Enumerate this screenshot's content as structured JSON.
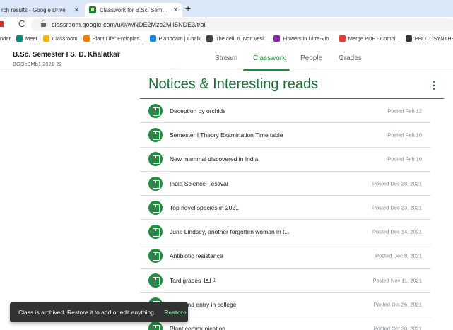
{
  "browser": {
    "tabs": [
      {
        "title": "rch results - Google Drive",
        "close": "✕"
      },
      {
        "title": "Classwork for B.Sc. Semester I S",
        "close": "✕"
      }
    ],
    "new_tab": "+",
    "reload": "C",
    "url": "classroom.google.com/u/0/w/NDE2Mzc2MjI5NDE3/t/all",
    "bookmarks": [
      {
        "label": "ndar",
        "icon_color": ""
      },
      {
        "label": "Meet",
        "icon_color": "#00897b"
      },
      {
        "label": "Classroom",
        "icon_color": "#f4b400"
      },
      {
        "label": "Plant Life: Endoplas...",
        "icon_color": "#f57c00"
      },
      {
        "label": "Planboard | Chalk",
        "icon_color": "#1e88e5"
      },
      {
        "label": "The cell. 6. Non vesi...",
        "icon_color": "#444444"
      },
      {
        "label": "Flowers in Ultra-Vio...",
        "icon_color": "#8e24aa"
      },
      {
        "label": "Merge PDF - Combi...",
        "icon_color": "#e53935"
      },
      {
        "label": "PHOTOSYNTHESIS...",
        "icon_color": "#333333"
      }
    ]
  },
  "classroom": {
    "class_name": "B.Sc. Semester I S. D. Khalatkar",
    "class_code": "BG3lcBMb1 2021-22",
    "nav": {
      "stream": "Stream",
      "classwork": "Classwork",
      "people": "People",
      "grades": "Grades"
    }
  },
  "topic": {
    "title": "Notices & Interesting reads",
    "menu": "⋮"
  },
  "materials": [
    {
      "title": "Deception by orchids",
      "date": "Posted Feb 12",
      "attachments": ""
    },
    {
      "title": "Semester I Theory Examination Time table",
      "date": "Posted Feb 10",
      "attachments": ""
    },
    {
      "title": "New mammal discovered in India",
      "date": "Posted Feb 10",
      "attachments": ""
    },
    {
      "title": "India Science Festival",
      "date": "Posted Dec 28, 2021",
      "attachments": ""
    },
    {
      "title": "Top novel species in 2021",
      "date": "Posted Dec 23, 2021",
      "attachments": ""
    },
    {
      "title": "June Lindsey, another forgotten woman in t...",
      "date": "Posted Dec 14, 2021",
      "attachments": ""
    },
    {
      "title": "Antibiotic resistance",
      "date": "Posted Dec 8, 2021",
      "attachments": ""
    },
    {
      "title": "Tardigrades",
      "date": "Posted Nov 11, 2021",
      "attachments": "1"
    },
    {
      "title": "ation and entry in college",
      "date": "Posted Oct 26, 2021",
      "attachments": ""
    },
    {
      "title": "Plant communication",
      "date": "Posted Oct 20, 2021",
      "attachments": ""
    }
  ],
  "snackbar": {
    "message": "Class is archived. Restore it to add or edit anything.",
    "action": "Restore"
  },
  "colors": {
    "accent": "#1e8e3e",
    "topic_title": "#137333",
    "snackbar_bg": "#323232",
    "snackbar_action": "#81c995"
  }
}
